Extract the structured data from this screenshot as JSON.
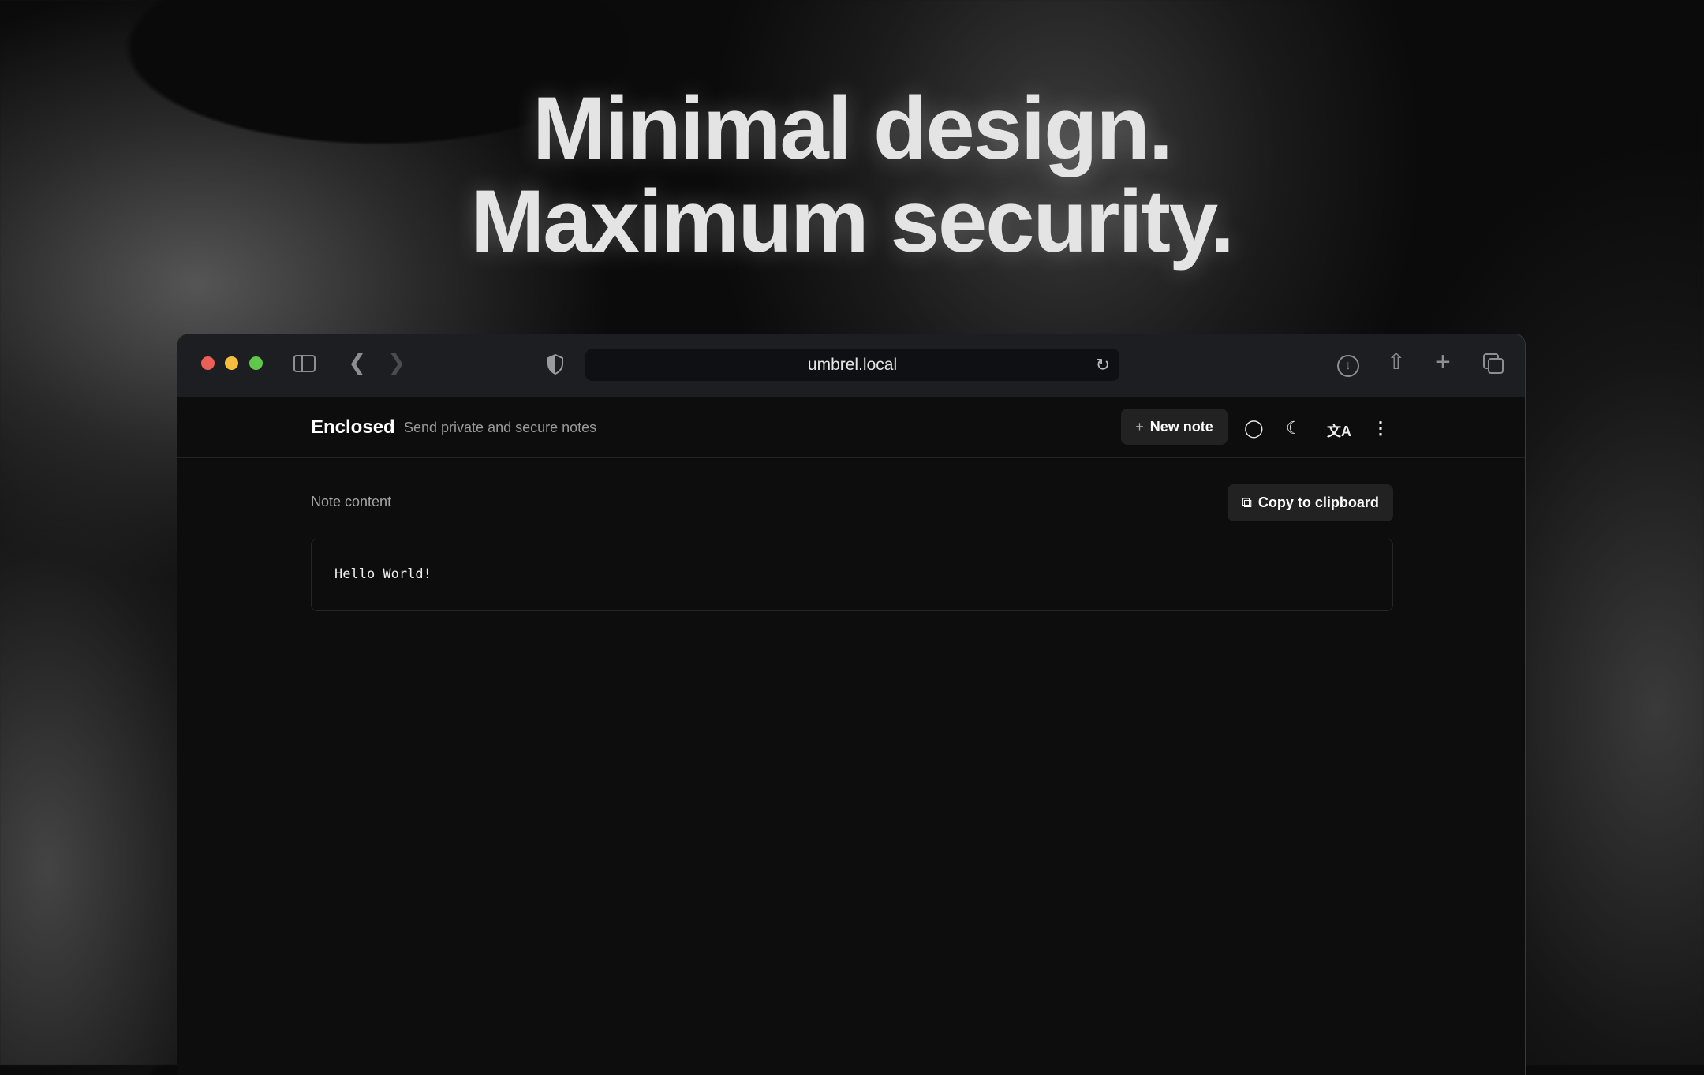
{
  "hero": {
    "line1": "Minimal design.",
    "line2": "Maximum security."
  },
  "browser": {
    "url": "umbrel.local",
    "traffic_lights": {
      "close": "#ec5f57",
      "minimize": "#f4bd3e",
      "maximize": "#5fc84a"
    }
  },
  "app": {
    "brand": "Enclosed",
    "tagline": "Send private and secure notes",
    "new_note_label": "New note",
    "new_note_icon": "+"
  },
  "note": {
    "label": "Note content",
    "copy_label": "Copy to clipboard",
    "content": "Hello World!"
  }
}
